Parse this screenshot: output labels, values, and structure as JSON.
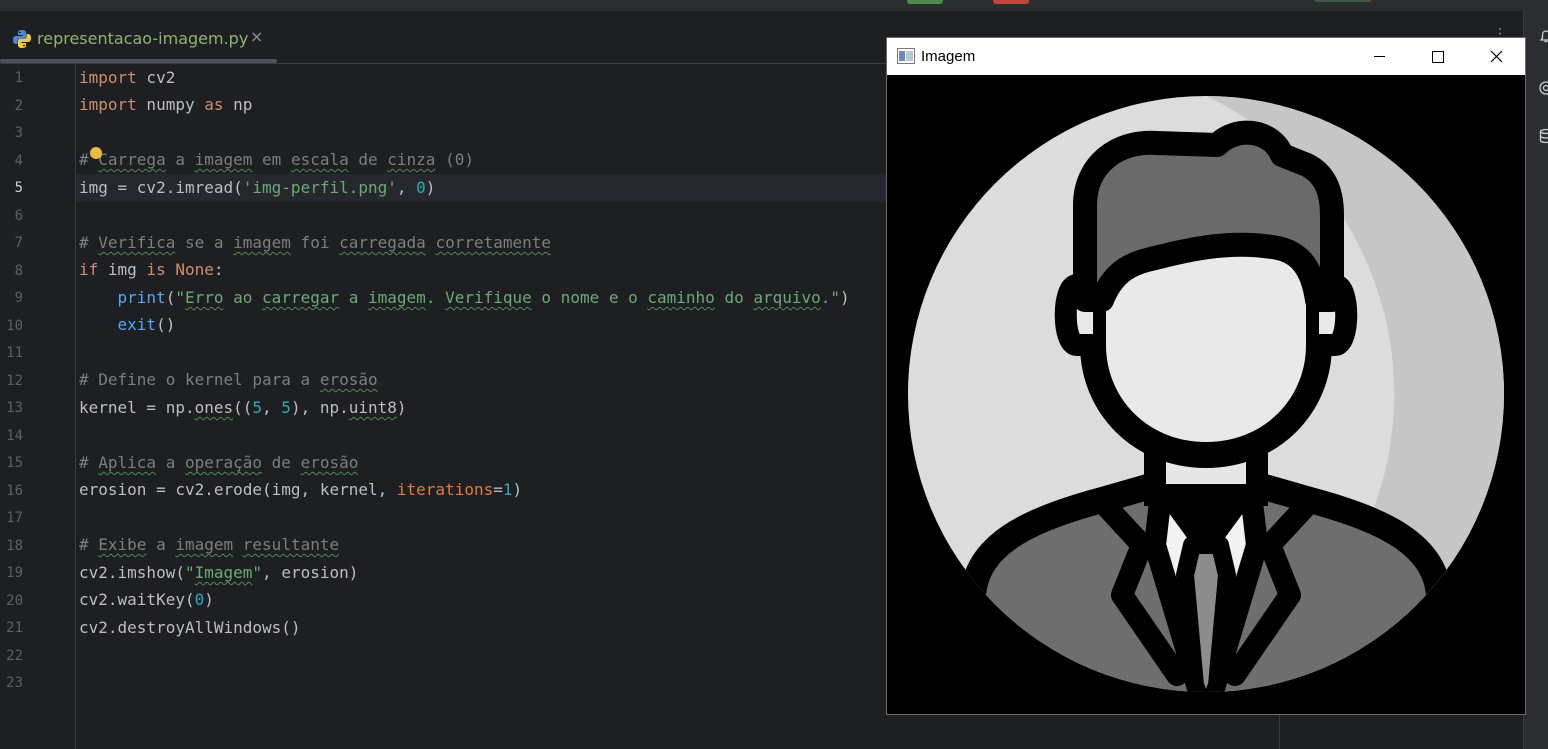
{
  "editor": {
    "tab": {
      "filename": "representacao-imagem.py",
      "close_glyph": "×",
      "icon": "python-icon"
    },
    "current_line": 5,
    "line_numbers": [
      "1",
      "2",
      "3",
      "4",
      "5",
      "6",
      "7",
      "8",
      "9",
      "10",
      "11",
      "12",
      "13",
      "14",
      "15",
      "16",
      "17",
      "18",
      "19",
      "20",
      "21",
      "22",
      "23"
    ]
  },
  "cv_window": {
    "title": "Imagem",
    "icon": "opencv-window-icon",
    "buttons": [
      "minimize",
      "maximize",
      "close"
    ]
  },
  "right_toolbar": {
    "icons": [
      "bell-icon",
      "ai-assistant-icon",
      "database-icon"
    ]
  },
  "colors": {
    "editor_bg": "#1e1f22",
    "keyword": "#cf8e6d",
    "string": "#6aab73",
    "number": "#2aacb8",
    "comment": "#7a7e85",
    "tab_filename": "#8fb56a"
  }
}
